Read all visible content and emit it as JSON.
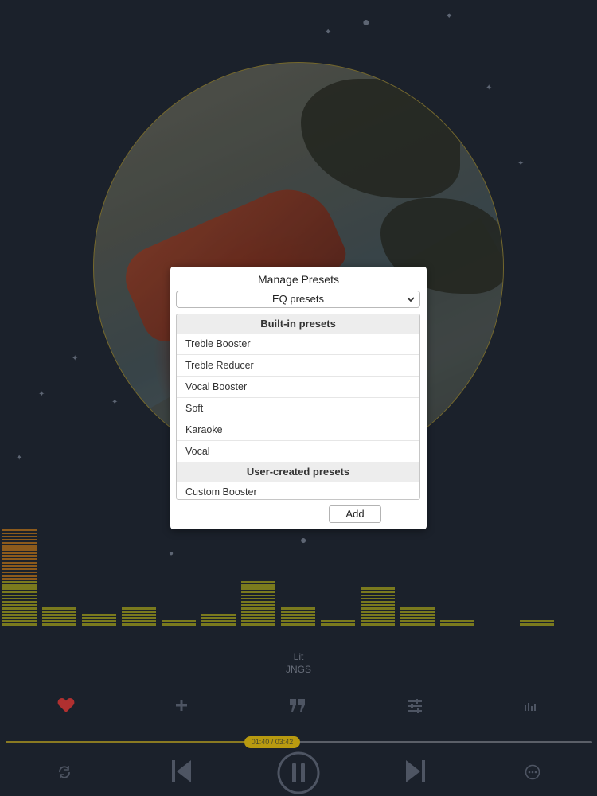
{
  "dialog": {
    "title": "Manage Presets",
    "select_value": "EQ presets",
    "builtin_header": "Built-in presets",
    "builtin_presets": [
      "Treble Booster",
      "Treble Reducer",
      "Vocal Booster",
      "Soft",
      "Karaoke",
      "Vocal"
    ],
    "user_header": "User-created presets",
    "user_presets": [
      "Custom Booster"
    ],
    "add_label": "Add"
  },
  "track": {
    "title": "Lit",
    "artist": "JNGS"
  },
  "playback": {
    "time": "01:40 / 03:42",
    "progress": 0.45
  },
  "eq_levels": [
    30,
    6,
    4,
    6,
    2,
    4,
    14,
    6,
    2,
    12,
    6,
    2,
    0,
    2
  ],
  "colors": {
    "eq_low": "#7a7a1e",
    "eq_high": "#8c5a1c",
    "accent": "#b89a10",
    "favorite": "#b03030"
  },
  "icons": {
    "favorite": "heart-icon",
    "add": "plus-icon",
    "lyrics": "quote-icon",
    "equalizer": "sliders-icon",
    "visualizer": "bars-icon",
    "repeat": "repeat-icon",
    "previous": "previous-icon",
    "pause": "pause-icon",
    "next": "next-icon",
    "more": "more-icon"
  }
}
